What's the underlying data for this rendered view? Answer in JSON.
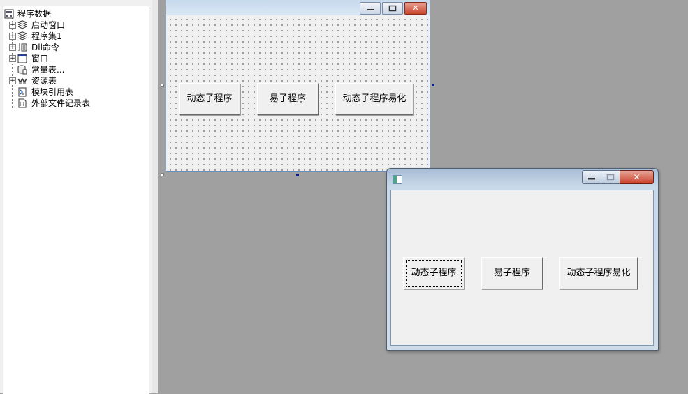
{
  "tree": {
    "root": "程序数据",
    "items": [
      {
        "label": "启动窗口",
        "icon": "stack-icon",
        "expandable": true
      },
      {
        "label": "程序集1",
        "icon": "stack-icon",
        "expandable": true
      },
      {
        "label": "Dll命令",
        "icon": "dll-command-icon",
        "expandable": true
      },
      {
        "label": "窗口",
        "icon": "window-icon",
        "expandable": true
      },
      {
        "label": "常量表...",
        "icon": "constant-table-icon",
        "expandable": false
      },
      {
        "label": "资源表",
        "icon": "resource-table-icon",
        "expandable": true
      },
      {
        "label": "模块引用表",
        "icon": "module-reference-icon",
        "expandable": false
      },
      {
        "label": "外部文件记录表",
        "icon": "file-record-icon",
        "expandable": false
      }
    ]
  },
  "designer": {
    "buttons": [
      "动态子程序",
      "易子程序",
      "动态子程序易化"
    ]
  },
  "run_window": {
    "buttons": [
      "动态子程序",
      "易子程序",
      "动态子程序易化"
    ],
    "close_glyph": "✕"
  },
  "colors": {
    "workspace": "#a0a0a0",
    "title_blue": "#c9d9ea",
    "close_red": "#c7422b",
    "handle_navy": "#0a1e7a"
  }
}
